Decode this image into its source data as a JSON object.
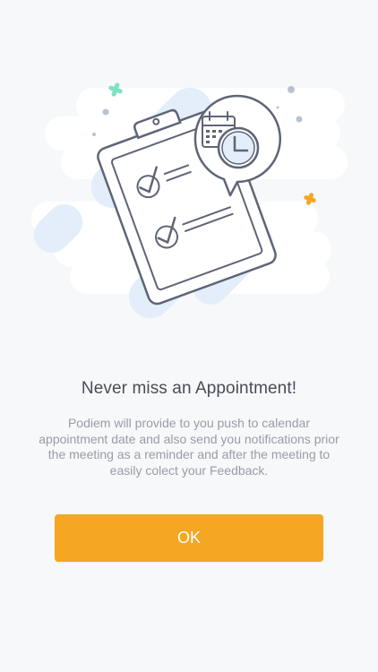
{
  "onboarding": {
    "title": "Never miss an Appointment!",
    "description": "Podiem will provide to you push to calendar appointment date and also send you  notifications prior the meeting as a reminder and after the meeting to easily colect your Feedback.",
    "ok_label": "OK"
  },
  "illustration": {
    "name": "clipboard-calendar-clock-illustration",
    "icons": [
      "clipboard-icon",
      "checkmark-icon",
      "calendar-icon",
      "clock-icon",
      "sparkle-icon"
    ]
  },
  "colors": {
    "background": "#f7f8fa",
    "accent": "#f5a623",
    "title_text": "#4a4c57",
    "body_text": "#9a9ca6",
    "illustration_stroke": "#5f6577",
    "illustration_blob": "#e3eefa",
    "sparkle_green": "#7fe0c5",
    "sparkle_orange": "#f5a623"
  }
}
